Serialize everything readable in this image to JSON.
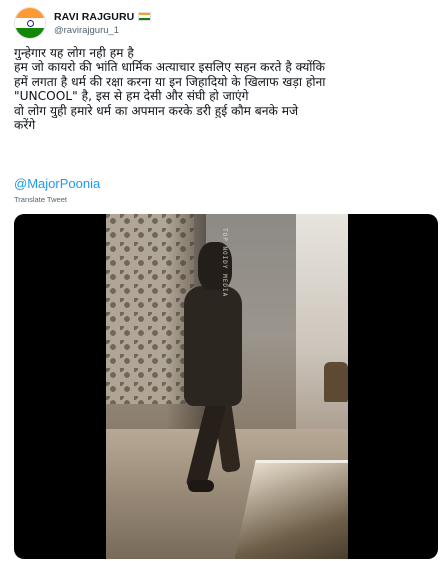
{
  "author": {
    "display_name": "RAVI RAJGURU",
    "handle": "@ravirajguru_1",
    "avatar_icon": "india-flag-avatar",
    "badge_icon": "india-flag-icon",
    "flag_colors": {
      "saffron": "#ff9933",
      "white": "#ffffff",
      "green": "#138808",
      "chakra": "#1a237e"
    }
  },
  "tweet": {
    "lines": [
      "गुन्हेगार यह लोग नही हम है",
      "हम जो कायरो की भांति धार्मिक अत्याचार इसलिए सहन करते है क्योंकि",
      "हमें लगता है धर्म की रक्षा करना या इन जिहादियो के खिलाफ खड़ा होना",
      "\"UNCOOL\" है, इस से हम देसी और संघी हो जाएंगे",
      "वो लोग युही हमारे धर्म का अपमान करके डरी हुई कौम बनके मजे",
      "करेंगे"
    ],
    "mention": "@MajorPoonia",
    "translate_label": "Translate Tweet"
  },
  "media": {
    "watermark": "TOP NOIDY MEDIA"
  },
  "colors": {
    "text": "#0f1419",
    "secondary": "#536471",
    "link": "#1d9bf0"
  }
}
